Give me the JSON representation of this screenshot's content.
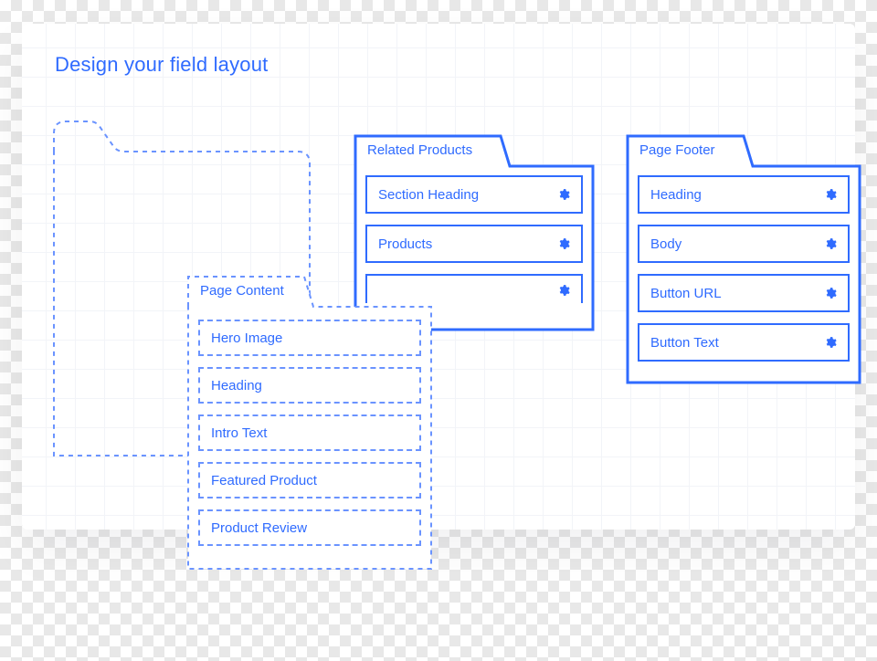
{
  "title": "Design your field layout",
  "panels": {
    "page_content": {
      "label": "Page Content",
      "fields": [
        "Hero Image",
        "Heading",
        "Intro Text",
        "Featured Product",
        "Product Review"
      ]
    },
    "related_products": {
      "label": "Related Products",
      "fields": [
        "Section Heading",
        "Products"
      ]
    },
    "page_footer": {
      "label": "Page Footer",
      "fields": [
        "Heading",
        "Body",
        "Button URL",
        "Button Text"
      ]
    }
  },
  "colors": {
    "primary": "#2f6bff",
    "dash": "#6a93ff"
  }
}
